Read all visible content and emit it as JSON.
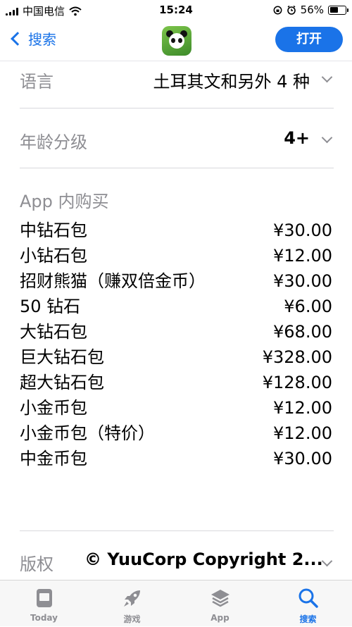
{
  "status_bar": {
    "carrier": "中国电信",
    "time": "15:24",
    "battery_percent": "56%",
    "battery_level": 0.56
  },
  "nav": {
    "back_label": "搜索",
    "open_label": "打开"
  },
  "info": {
    "language_label": "语言",
    "language_value": "土耳其文和另外 4 种",
    "age_label": "年龄分级",
    "age_value": "4+",
    "iap_label": "App 内购买",
    "copyright_label": "版权",
    "copyright_value": "© YuuCorp Copyright 2..."
  },
  "iap_items": [
    {
      "name": "中钻石包",
      "price": "¥30.00"
    },
    {
      "name": "小钻石包",
      "price": "¥12.00"
    },
    {
      "name": "招财熊猫（赚双倍金币）",
      "price": "¥30.00"
    },
    {
      "name": "50 钻石",
      "price": "¥6.00"
    },
    {
      "name": "大钻石包",
      "price": "¥68.00"
    },
    {
      "name": "巨大钻石包",
      "price": "¥328.00"
    },
    {
      "name": "超大钻石包",
      "price": "¥128.00"
    },
    {
      "name": "小金币包",
      "price": "¥12.00"
    },
    {
      "name": "小金币包（特价）",
      "price": "¥12.00"
    },
    {
      "name": "中金币包",
      "price": "¥30.00"
    }
  ],
  "tabs": [
    {
      "label": "Today",
      "icon": "today-icon"
    },
    {
      "label": "游戏",
      "icon": "rocket-icon"
    },
    {
      "label": "App",
      "icon": "layers-icon"
    },
    {
      "label": "搜索",
      "icon": "search-icon"
    }
  ],
  "colors": {
    "accent": "#1a73e8",
    "secondary_text": "#8e8e93"
  }
}
